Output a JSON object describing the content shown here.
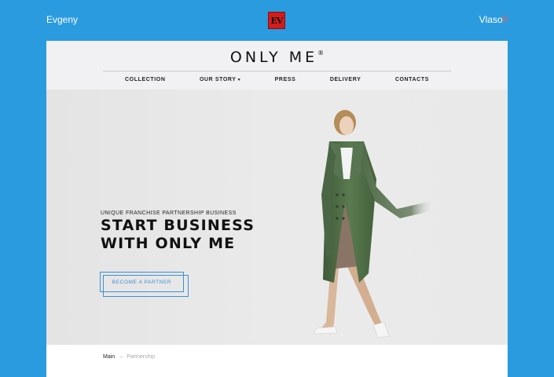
{
  "author_left": "Evgeny",
  "author_logo": "EV",
  "author_right_main": "Vlaso",
  "author_right_accent": "F",
  "site": {
    "brand": "ONLY ME",
    "brand_mark": "®",
    "nav": [
      {
        "label": "COLLECTION"
      },
      {
        "label": "OUR STORY",
        "has_dropdown": true
      },
      {
        "label": "PRESS"
      },
      {
        "label": "DELIVERY"
      },
      {
        "label": "CONTACTS"
      }
    ]
  },
  "hero": {
    "kicker": "UNIQUE FRANCHISE PARTNERSHIP BUSINESS",
    "title_line1": "START BUSINESS",
    "title_line2": "WITH ONLY ME",
    "cta": "BECOME A PARTNER"
  },
  "breadcrumbs": {
    "main": "Main",
    "separator": "→",
    "current": "Partnership"
  },
  "colors": {
    "background": "#2b9be0",
    "accent": "#3b8fd6",
    "logo_red": "#d41c1c",
    "coat": "#4e6a45"
  }
}
